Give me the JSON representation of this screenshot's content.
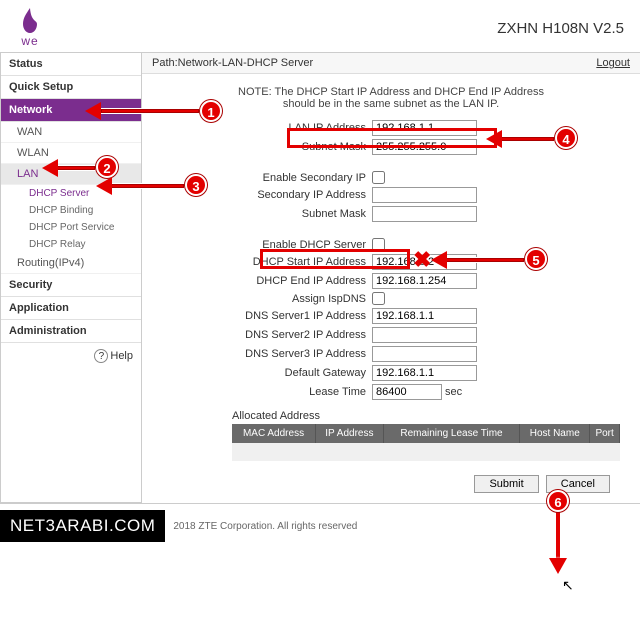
{
  "header": {
    "brand_text": "we",
    "model": "ZXHN H108N V2.5"
  },
  "sidebar": {
    "status": "Status",
    "quick_setup": "Quick Setup",
    "network": "Network",
    "wan": "WAN",
    "wlan": "WLAN",
    "lan": "LAN",
    "dhcp_server": "DHCP Server",
    "dhcp_binding": "DHCP Binding",
    "dhcp_port_service": "DHCP Port Service",
    "dhcp_relay": "DHCP Relay",
    "routing": "Routing(IPv4)",
    "security": "Security",
    "application": "Application",
    "administration": "Administration",
    "help": "Help"
  },
  "path": {
    "label": "Path:Network-LAN-DHCP Server",
    "logout": "Logout"
  },
  "note": "NOTE: The DHCP Start IP Address and DHCP End IP Address should be in the same subnet as the LAN IP.",
  "form": {
    "lan_ip_label": "LAN IP Address",
    "lan_ip_value": "192.168.1.1",
    "subnet_label": "Subnet Mask",
    "subnet_value": "255.255.255.0",
    "enable_secondary_label": "Enable Secondary IP",
    "secondary_ip_label": "Secondary IP Address",
    "secondary_ip_value": "",
    "secondary_subnet_label": "Subnet Mask",
    "secondary_subnet_value": "",
    "enable_dhcp_label": "Enable DHCP Server",
    "dhcp_start_label": "DHCP Start IP Address",
    "dhcp_start_value": "192.168.1.2",
    "dhcp_end_label": "DHCP End IP Address",
    "dhcp_end_value": "192.168.1.254",
    "assign_ispdns_label": "Assign IspDNS",
    "dns1_label": "DNS Server1 IP Address",
    "dns1_value": "192.168.1.1",
    "dns2_label": "DNS Server2 IP Address",
    "dns2_value": "",
    "dns3_label": "DNS Server3 IP Address",
    "dns3_value": "",
    "gateway_label": "Default Gateway",
    "gateway_value": "192.168.1.1",
    "lease_label": "Lease Time",
    "lease_value": "86400",
    "lease_unit": "sec"
  },
  "alloc": {
    "header": "Allocated Address",
    "cols": {
      "mac": "MAC Address",
      "ip": "IP Address",
      "remaining": "Remaining Lease Time",
      "host": "Host Name",
      "port": "Port"
    }
  },
  "buttons": {
    "submit": "Submit",
    "cancel": "Cancel"
  },
  "footer": {
    "brand": "NET3ARABI.COM",
    "copyright": "2018 ZTE Corporation. All rights reserved"
  },
  "anno": {
    "b1": "1",
    "b2": "2",
    "b3": "3",
    "b4": "4",
    "b5": "5",
    "b6": "6"
  }
}
